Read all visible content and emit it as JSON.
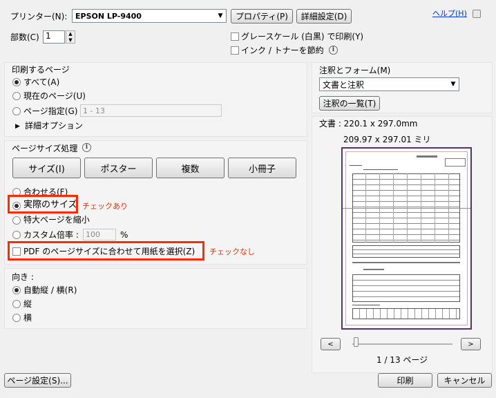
{
  "printer": {
    "label": "プリンター(N):",
    "value": "EPSON LP-9400"
  },
  "buttons": {
    "properties": "プロパティ(P)",
    "advanced": "詳細設定(D)",
    "help": "ヘルプ(H)",
    "page_setup": "ページ設定(S)...",
    "print": "印刷",
    "cancel": "キャンセル"
  },
  "copies": {
    "label": "部数(C) :",
    "value": "1"
  },
  "options": {
    "grayscale": "グレースケール (白黒) で印刷(Y)",
    "save_ink": "インク / トナーを節約"
  },
  "pages_to_print": {
    "title": "印刷するページ",
    "all": "すべて(A)",
    "current": "現在のページ(U)",
    "pages": "ページ指定(G)",
    "pages_placeholder": "1 - 13",
    "more_options": "詳細オプション"
  },
  "page_sizing": {
    "title": "ページサイズ処理",
    "tabs": [
      "サイズ(I)",
      "ポスター",
      "複数",
      "小冊子"
    ],
    "fit": "合わせる(F)",
    "actual_size": "実際のサイズ",
    "shrink": "特大ページを縮小",
    "custom_scale": "カスタム倍率 :",
    "custom_value": "100",
    "percent": "%",
    "choose_paper": "PDF のページサイズに合わせて用紙を選択(Z)"
  },
  "annotations": {
    "checked_note": "チェックあり",
    "unchecked_note": "チェックなし"
  },
  "orientation": {
    "title": "向き :",
    "auto": "自動縦 / 横(R)",
    "portrait": "縦",
    "landscape": "横"
  },
  "comments_forms": {
    "title": "注釈とフォーム(M)",
    "value": "文書と注釈",
    "summarize": "注釈の一覧(T)"
  },
  "preview": {
    "doc_size": "文書 : 220.1 x 297.0mm",
    "paper_size": "209.97 x 297.01 ミリ",
    "prev": "<",
    "next": ">",
    "page_indicator": "1 / 13 ページ",
    "slider_fraction": 0
  },
  "colors": {
    "annotation_red": "#ff2a00",
    "preview_border": "#5a2f6e"
  }
}
